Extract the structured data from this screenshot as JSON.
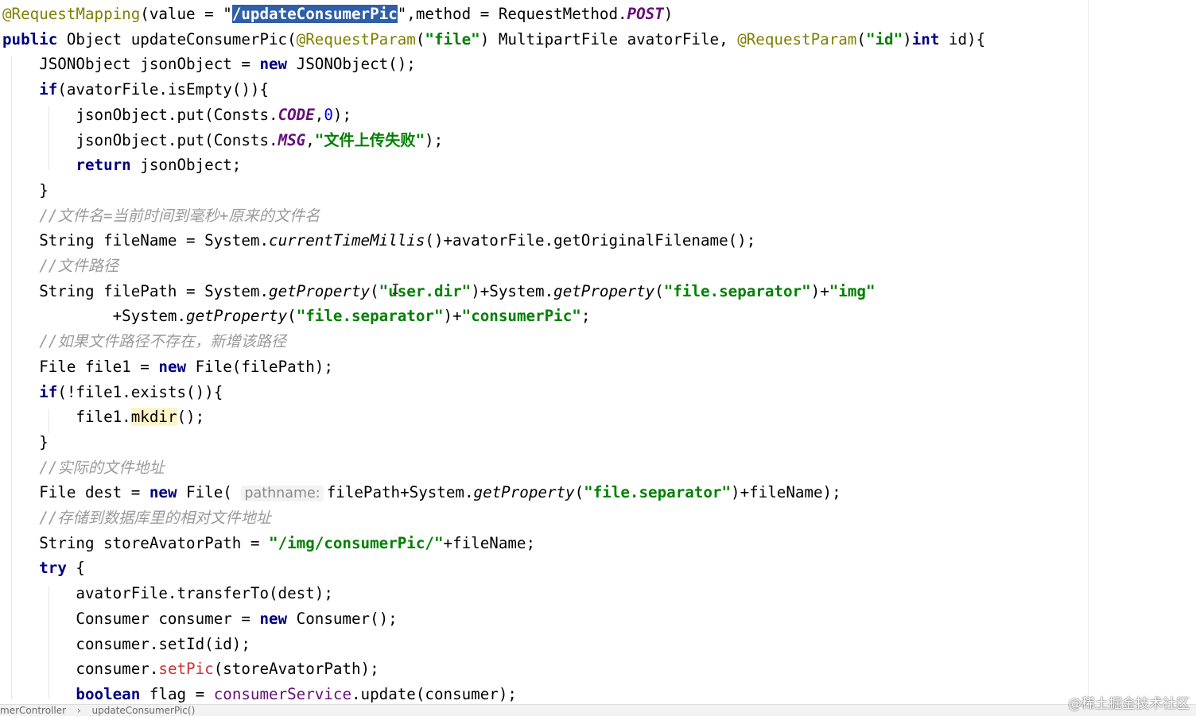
{
  "editor": {
    "lines": [
      [
        {
          "t": "@RequestMapping",
          "c": "ann"
        },
        {
          "t": "(value = \""
        },
        {
          "t": "/updateConsumerPic",
          "c": "str sel"
        },
        {
          "t": "\",method = RequestMethod."
        },
        {
          "t": "POST",
          "c": "static-field"
        },
        {
          "t": ")"
        }
      ],
      [
        {
          "t": "public",
          "c": "kw"
        },
        {
          "t": " Object updateConsumerPic("
        },
        {
          "t": "@RequestParam",
          "c": "ann"
        },
        {
          "t": "("
        },
        {
          "t": "\"file\"",
          "c": "str"
        },
        {
          "t": ") MultipartFile avatorFile, "
        },
        {
          "t": "@RequestParam",
          "c": "ann"
        },
        {
          "t": "("
        },
        {
          "t": "\"id\"",
          "c": "str"
        },
        {
          "t": ")"
        },
        {
          "t": "int",
          "c": "kw"
        },
        {
          "t": " id){"
        }
      ],
      [
        {
          "t": "    JSONObject jsonObject = "
        },
        {
          "t": "new",
          "c": "kw"
        },
        {
          "t": " JSONObject();"
        }
      ],
      [
        {
          "t": "    "
        },
        {
          "t": "if",
          "c": "kw"
        },
        {
          "t": "(avatorFile.isEmpty()){"
        }
      ],
      [
        {
          "t": "        jsonObject.put(Consts."
        },
        {
          "t": "CODE",
          "c": "static-field"
        },
        {
          "t": ","
        },
        {
          "t": "0",
          "c": "num"
        },
        {
          "t": ");"
        }
      ],
      [
        {
          "t": "        jsonObject.put(Consts."
        },
        {
          "t": "MSG",
          "c": "static-field"
        },
        {
          "t": ","
        },
        {
          "t": "\"文件上传失败\"",
          "c": "str"
        },
        {
          "t": ");"
        }
      ],
      [
        {
          "t": "        "
        },
        {
          "t": "return",
          "c": "kw"
        },
        {
          "t": " jsonObject;"
        }
      ],
      [
        {
          "t": "    }"
        }
      ],
      [
        {
          "t": "    "
        },
        {
          "t": "//文件名=当前时间到毫秒+原来的文件名",
          "c": "comment"
        }
      ],
      [
        {
          "t": "    String fileName = System."
        },
        {
          "t": "currentTimeMillis",
          "c": "static-call"
        },
        {
          "t": "()+avatorFile.getOriginalFilename();"
        }
      ],
      [
        {
          "t": "    "
        },
        {
          "t": "//文件路径",
          "c": "comment"
        }
      ],
      [
        {
          "t": "    String filePath = System."
        },
        {
          "t": "getProperty",
          "c": "static-call"
        },
        {
          "t": "("
        },
        {
          "t": "\"user.dir\"",
          "c": "str"
        },
        {
          "t": ")+System."
        },
        {
          "t": "getProperty",
          "c": "static-call"
        },
        {
          "t": "("
        },
        {
          "t": "\"file.separator\"",
          "c": "str"
        },
        {
          "t": ")+"
        },
        {
          "t": "\"img\"",
          "c": "str"
        }
      ],
      [
        {
          "t": "            +System."
        },
        {
          "t": "getProperty",
          "c": "static-call"
        },
        {
          "t": "("
        },
        {
          "t": "\"file.separator\"",
          "c": "str"
        },
        {
          "t": ")+"
        },
        {
          "t": "\"consumerPic\"",
          "c": "str"
        },
        {
          "t": ";"
        }
      ],
      [
        {
          "t": "    "
        },
        {
          "t": "//如果文件路径不存在，新增该路径",
          "c": "comment"
        }
      ],
      [
        {
          "t": "    File file1 = "
        },
        {
          "t": "new",
          "c": "kw"
        },
        {
          "t": " File(filePath);"
        }
      ],
      [
        {
          "t": "    "
        },
        {
          "t": "if",
          "c": "kw"
        },
        {
          "t": "(!file1.exists()){"
        }
      ],
      [
        {
          "t": "        file1."
        },
        {
          "t": "mkdir",
          "c": "hl"
        },
        {
          "t": "();"
        }
      ],
      [
        {
          "t": "    }"
        }
      ],
      [
        {
          "t": "    "
        },
        {
          "t": "//实际的文件地址",
          "c": "comment"
        }
      ],
      [
        {
          "t": "    File dest = "
        },
        {
          "t": "new",
          "c": "kw"
        },
        {
          "t": " File( "
        },
        {
          "t": "pathname:",
          "c": "hint"
        },
        {
          "t": "filePath+System."
        },
        {
          "t": "getProperty",
          "c": "static-call"
        },
        {
          "t": "("
        },
        {
          "t": "\"file.separator\"",
          "c": "str"
        },
        {
          "t": ")+fileName);"
        }
      ],
      [
        {
          "t": "    "
        },
        {
          "t": "//存储到数据库里的相对文件地址",
          "c": "comment"
        }
      ],
      [
        {
          "t": "    String storeAvatorPath = "
        },
        {
          "t": "\"/img/consumerPic/\"",
          "c": "str"
        },
        {
          "t": "+fileName;"
        }
      ],
      [
        {
          "t": "    "
        },
        {
          "t": "try",
          "c": "kw"
        },
        {
          "t": " {"
        }
      ],
      [
        {
          "t": "        avatorFile.transferTo(dest);"
        }
      ],
      [
        {
          "t": "        Consumer consumer = "
        },
        {
          "t": "new",
          "c": "kw"
        },
        {
          "t": " Consumer();"
        }
      ],
      [
        {
          "t": "        consumer.setId(id);"
        }
      ],
      [
        {
          "t": "        consumer."
        },
        {
          "t": "setPic",
          "c": "err"
        },
        {
          "t": "(storeAvatorPath);"
        }
      ],
      [
        {
          "t": "        "
        },
        {
          "t": "boolean",
          "c": "kw"
        },
        {
          "t": " flag = "
        },
        {
          "t": "consumerService",
          "c": "field"
        },
        {
          "t": ".update(consumer);"
        }
      ]
    ]
  },
  "cursor_glyph": "I",
  "breadcrumb": {
    "class_name": "merController",
    "separator": "›",
    "method_name": "updateConsumerPic()"
  },
  "watermark": "@稀土掘金技术社区"
}
